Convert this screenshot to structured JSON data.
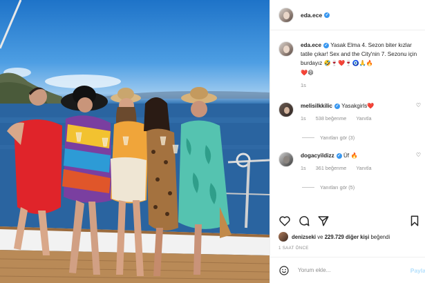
{
  "post": {
    "author": "eda.ece",
    "caption_username": "eda.ece",
    "caption_text": "Yasak Elma 4. Sezon biter kızlar tatile çıkar! Sex and the City'nin 7. Sezonu için burdayız",
    "caption_emojis": "🤣🍷❤️🍷🧿🙏🔥",
    "caption_emojis_line2": "❤️😄",
    "caption_age": "1s"
  },
  "comments": [
    {
      "username": "melisilkkilic",
      "text": "Yasakgirls",
      "emoji": "❤️",
      "age": "1s",
      "likes": "538 beğenme",
      "reply_label": "Yanıtla",
      "replies_label": "Yanıtları gör (3)"
    },
    {
      "username": "dogacyildizz",
      "text": "Üf",
      "emoji": "🔥",
      "age": "1s",
      "likes": "361 beğenme",
      "reply_label": "Yanıtla",
      "replies_label": "Yanıtları gör (5)"
    }
  ],
  "likes_line": {
    "first_user": "denizseki",
    "connector": " ve ",
    "others": "229.729 diğer kişi",
    "suffix": " beğendi"
  },
  "post_time": "1 SAAT ÖNCE",
  "comment_box": {
    "placeholder": "Yorum ekle...",
    "post_label": "Payla"
  },
  "icons": {
    "heart": "heart-icon",
    "comment": "comment-icon",
    "share": "share-icon",
    "bookmark": "bookmark-icon",
    "emoji": "smile-icon"
  },
  "colors": {
    "verified": "#3897f0",
    "muted": "#8e8e8e",
    "text": "#262626"
  }
}
